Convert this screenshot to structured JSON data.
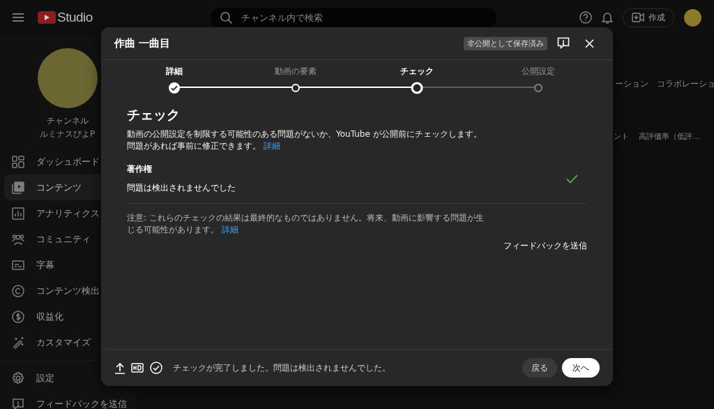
{
  "header": {
    "logo_text": "Studio",
    "search": {
      "placeholder": "チャンネル内で検索"
    },
    "create_button": "作成"
  },
  "channel": {
    "name": "チャンネル",
    "handle": "ルミナスぴよP"
  },
  "sidebar": {
    "items": [
      {
        "label": "ダッシュボード",
        "selected": false
      },
      {
        "label": "コンテンツ",
        "selected": true
      },
      {
        "label": "アナリティクス",
        "selected": false
      },
      {
        "label": "コミュニティ",
        "selected": false
      },
      {
        "label": "字幕",
        "selected": false
      },
      {
        "label": "コンテンツ検出",
        "selected": false
      },
      {
        "label": "収益化",
        "selected": false
      },
      {
        "label": "カスタマイズ",
        "selected": false
      }
    ],
    "bottom_items": [
      {
        "label": "設定"
      },
      {
        "label": "フィードバックを送信"
      }
    ]
  },
  "background": {
    "tabs": [
      "ーション",
      "コラボレーショ"
    ],
    "columns": [
      "ント",
      "高評価率（低評…"
    ]
  },
  "dialog": {
    "title": "作曲 一曲目",
    "badge": "非公開として保存済み",
    "steps": [
      {
        "label": "詳細",
        "kind": "done"
      },
      {
        "label": "動画の要素",
        "kind": "visited"
      },
      {
        "label": "チェック",
        "kind": "current"
      },
      {
        "label": "公開設定",
        "kind": "pending"
      }
    ],
    "heading": "チェック",
    "description": "動画の公開設定を制限する可能性のある問題がないか、YouTube が公開前にチェックします。問題があれば事前に修正できます。",
    "description_link": "詳細",
    "checks": [
      {
        "title": "著作権",
        "result": "問題は検出されませんでした",
        "passed": true
      }
    ],
    "note": "注意: これらのチェックの結果は最終的なものではありません。将来、動画に影響する問題が生じる可能性があります。",
    "note_link": "詳細",
    "feedback_link": "フィードバックを送信",
    "footer_status": "チェックが完了しました。問題は検出されませんでした。",
    "back_button": "戻る",
    "next_button": "次へ"
  }
}
